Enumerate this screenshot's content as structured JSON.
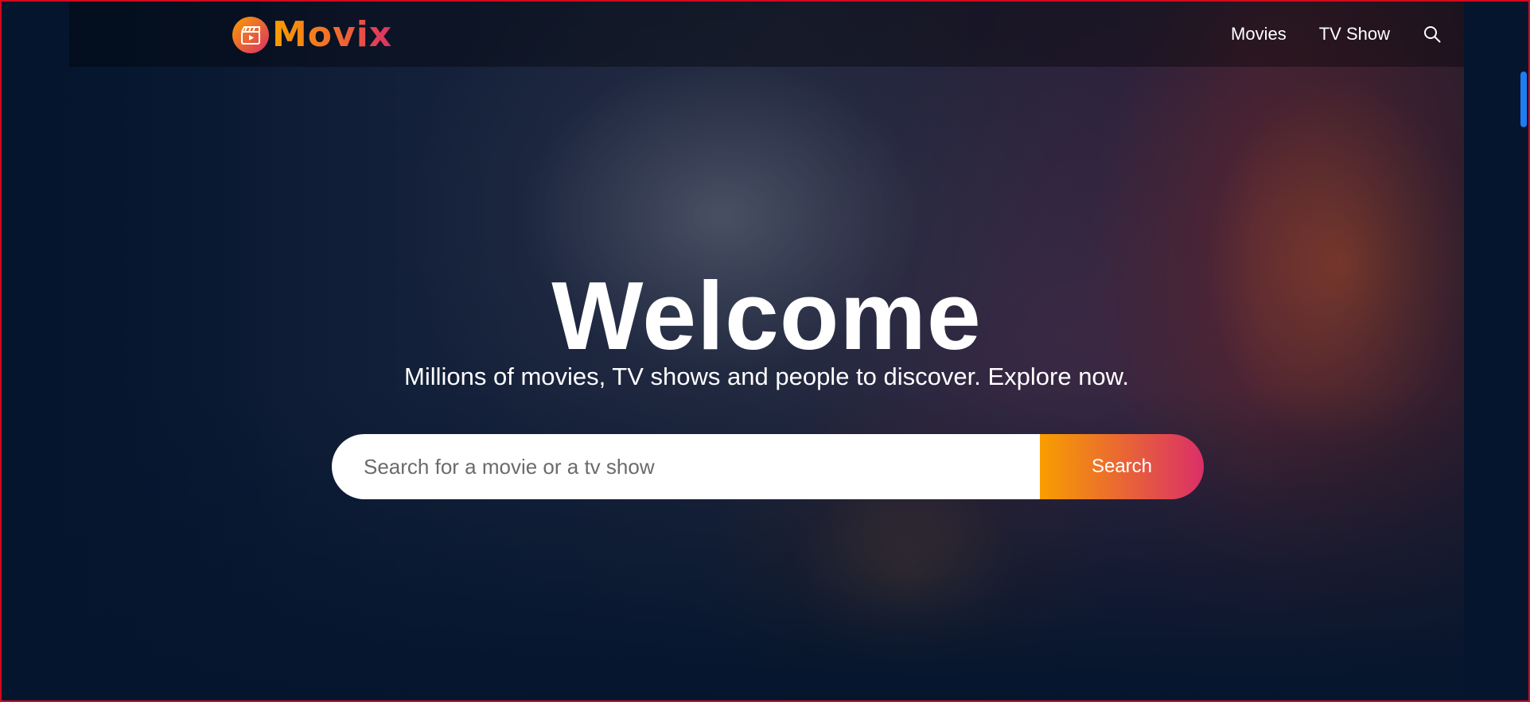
{
  "brand": {
    "name": "Movix",
    "colors": {
      "gradient_start": "#f89e00",
      "gradient_end": "#da2f68",
      "background": "#04152d"
    }
  },
  "header": {
    "nav": [
      {
        "label": "Movies",
        "icon": null
      },
      {
        "label": "TV Show",
        "icon": null
      }
    ],
    "search_icon": "search-icon"
  },
  "hero": {
    "title": "Welcome",
    "subtitle": "Millions of movies, TV shows and people to discover. Explore now.",
    "search": {
      "placeholder": "Search for a movie or a tv show",
      "value": "",
      "button_label": "Search"
    }
  }
}
